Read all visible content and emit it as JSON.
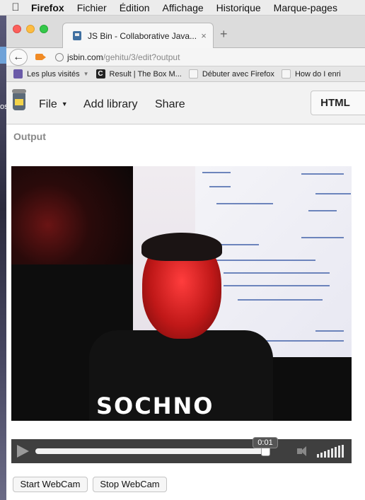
{
  "menubar": {
    "apple_icon": "apple-icon",
    "items": [
      "Firefox",
      "Fichier",
      "Édition",
      "Affichage",
      "Historique",
      "Marque-pages"
    ]
  },
  "desktop": {
    "edge_text": "os"
  },
  "browser": {
    "tab": {
      "title": "JS Bin - Collaborative Java...",
      "close": "×"
    },
    "new_tab": "+",
    "url": {
      "host": "jsbin.com",
      "path": "/gehitu/3/edit?output"
    },
    "bookmarks": [
      {
        "label": "Les plus visités",
        "icon": "bookmark-folder-icon"
      },
      {
        "label": "Result | The Box M...",
        "icon": "c-logo-icon"
      },
      {
        "label": "Débuter avec Firefox",
        "icon": "page-icon"
      },
      {
        "label": "How do I enri",
        "icon": "page-icon"
      }
    ]
  },
  "jsbin": {
    "menu": {
      "file": "File",
      "add_library": "Add library",
      "share": "Share"
    },
    "panel_tab": "HTML",
    "output_label": "Output"
  },
  "video": {
    "shirt_text": "SOCHNO",
    "time": "0:01",
    "progress_fraction": 0.99
  },
  "buttons": {
    "start": "Start WebCam",
    "stop": "Stop WebCam"
  },
  "colors": {
    "accent_camera": "#f08a24",
    "controls_bg": "#3f3f3f"
  }
}
